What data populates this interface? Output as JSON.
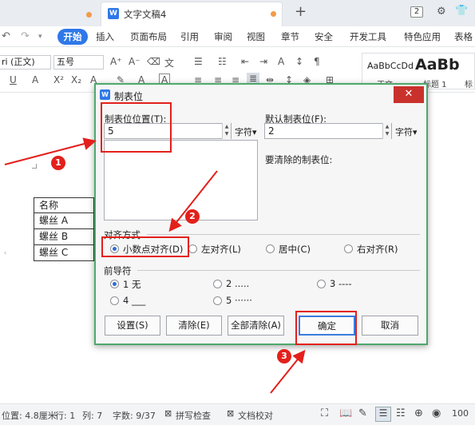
{
  "tabs": {
    "active_title": "文字文稿4",
    "plus": "+",
    "count_badge": "2"
  },
  "menu": {
    "undo_icon": "undo-icon",
    "redo_icon": "redo-icon",
    "start": "开始",
    "items": [
      "插入",
      "页面布局",
      "引用",
      "审阅",
      "视图",
      "章节",
      "安全",
      "开发工具",
      "特色应用",
      "表格"
    ]
  },
  "toolbar": {
    "font_name": "ri (正文)",
    "font_size": "五号",
    "style_preview_1": "AaBbCcDd",
    "style_preview_2": "AaBb",
    "style_name_1": "正文",
    "style_name_2": "标题 1",
    "style_name_3": "标"
  },
  "table": {
    "rows": [
      "名称",
      "螺丝 A",
      "螺丝 B",
      "螺丝 C"
    ]
  },
  "dialog": {
    "title": "制表位",
    "close": "✕",
    "tab_position_label": "制表位位置(T):",
    "tab_position_value": "5",
    "unit_1": "字符▾",
    "default_tab_label": "默认制表位(F):",
    "default_tab_value": "2",
    "unit_2": "字符▾",
    "to_clear_label": "要清除的制表位:",
    "alignment_group": "对齐方式",
    "alignment_options": [
      "小数点对齐(D)",
      "左对齐(L)",
      "居中(C)",
      "右对齐(R)"
    ],
    "leader_group": "前导符",
    "leader_options": [
      "1 无",
      "2 .....",
      "3 ----",
      "4 ___",
      "5 ······"
    ],
    "buttons": {
      "set": "设置(S)",
      "clear": "清除(E)",
      "clear_all": "全部清除(A)",
      "ok": "确定",
      "cancel": "取消"
    }
  },
  "annotations": [
    "1",
    "2",
    "3"
  ],
  "status": {
    "position": "位置: 4.8厘米",
    "row": "行: 1",
    "col": "列: 7",
    "wordcount": "字数: 9/37",
    "spell": "拼写检查",
    "proof": "文档校对",
    "zoom": "100"
  },
  "colors": {
    "accent": "#2f78e8",
    "dialog_border": "#4ea86b",
    "annotation": "#e3201b",
    "close_button": "#c9312c"
  }
}
